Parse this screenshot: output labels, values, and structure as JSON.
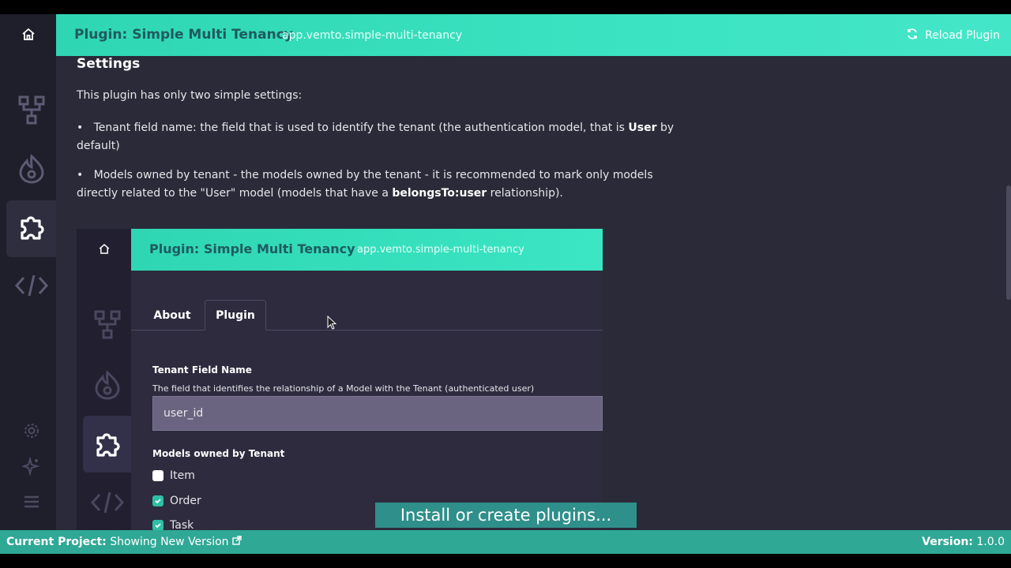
{
  "header": {
    "title": "Plugin: Simple Multi Tenancy",
    "subtitle": "app.vemto.simple-multi-tenancy",
    "reload_label": "Reload Plugin"
  },
  "content": {
    "heading": "Settings",
    "intro": "This plugin has only two simple settings:",
    "bullet1": {
      "text_a": "Tenant field name: the field that is used to identify the tenant (the authentication model, that is ",
      "bold": "User",
      "text_b": " by default)"
    },
    "bullet2": {
      "text_a": "Models owned by tenant - the models owned by the tenant - it is recommended to mark only models directly related to the \"User\" model (models that have a ",
      "bold": "belongsTo:user",
      "text_b": " relationship)."
    }
  },
  "embedded": {
    "title": "Plugin: Simple Multi Tenancy",
    "subtitle": "app.vemto.simple-multi-tenancy",
    "tabs": [
      {
        "label": "About",
        "active": false
      },
      {
        "label": "Plugin",
        "active": true
      }
    ],
    "tenant_field_label": "Tenant Field Name",
    "tenant_field_help": "The field that identifies the relationship of a Model with the Tenant (authenticated user)",
    "tenant_field_value": "user_id",
    "models_label": "Models owned by Tenant",
    "models": [
      {
        "name": "Item",
        "checked": false
      },
      {
        "name": "Order",
        "checked": true
      },
      {
        "name": "Task",
        "checked": true
      }
    ]
  },
  "caption": "Install or create plugins...",
  "footer": {
    "project_label": "Current Project:",
    "project_value": "Showing New Version",
    "version_label": "Version:",
    "version_value": "1.0.0"
  },
  "colors": {
    "accent": "#2fd6b3",
    "footer": "#2fa896",
    "sidebar": "#1f1f2b",
    "content_bg": "#2a2a38"
  }
}
